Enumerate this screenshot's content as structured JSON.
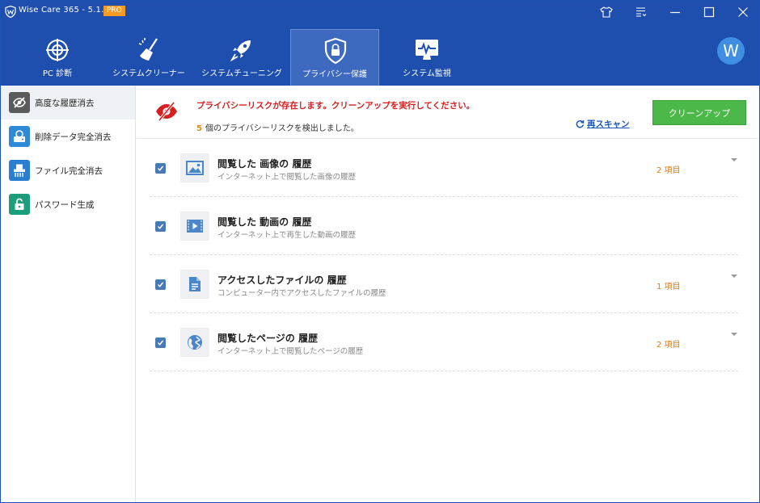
{
  "window": {
    "title": "Wise Care 365 - 5.1.9",
    "badge": "PRO"
  },
  "nav": {
    "tabs": [
      {
        "label": "PC 診断",
        "icon": "globe-target-icon"
      },
      {
        "label": "システムクリーナー",
        "icon": "broom-icon"
      },
      {
        "label": "システムチューニング",
        "icon": "rocket-icon"
      },
      {
        "label": "プライバシー保護",
        "icon": "shield-lock-icon",
        "active": true
      },
      {
        "label": "システム監視",
        "icon": "monitor-pulse-icon"
      }
    ]
  },
  "avatar": {
    "initial": "W"
  },
  "sidebar": {
    "items": [
      {
        "label": "高度な履歴消去",
        "icon": "eye-slash-icon",
        "active": true
      },
      {
        "label": "削除データ完全消去",
        "icon": "disk-erase-icon"
      },
      {
        "label": "ファイル完全消去",
        "icon": "shredder-icon"
      },
      {
        "label": "パスワード生成",
        "icon": "lock-icon"
      }
    ]
  },
  "alert": {
    "title": "プライバシーリスクが存在します。クリーンアップを実行してください。",
    "count": "5",
    "subtitle": "個のプライバシーリスクを検出しました。",
    "rescan": "再スキャン",
    "clean_button": "クリーンアップ"
  },
  "items": [
    {
      "title": "閲覧した 画像の 履歴",
      "desc": "インターネット上で閲覧した画像の履歴",
      "count": "2 項目",
      "icon": "image-icon",
      "has_caret": true
    },
    {
      "title": "閲覧した 動画の 履歴",
      "desc": "インターネット上で再生した動画の履歴",
      "count": "",
      "icon": "video-icon",
      "has_caret": false
    },
    {
      "title": "アクセスしたファイルの 履歴",
      "desc": "コンピューター内でアクセスしたファイルの履歴",
      "count": "1 項目",
      "icon": "document-icon",
      "has_caret": true
    },
    {
      "title": "閲覧したページの 履歴",
      "desc": "インターネット上で閲覧したページの履歴",
      "count": "2 項目",
      "icon": "globe-icon",
      "has_caret": true
    }
  ],
  "colors": {
    "header": "#1e4fae",
    "active_tab": "#3d69be",
    "alert_red": "#d42020",
    "count_orange": "#d87c1d",
    "clean_green": "#4cb84a",
    "link_blue": "#1a56b8"
  }
}
